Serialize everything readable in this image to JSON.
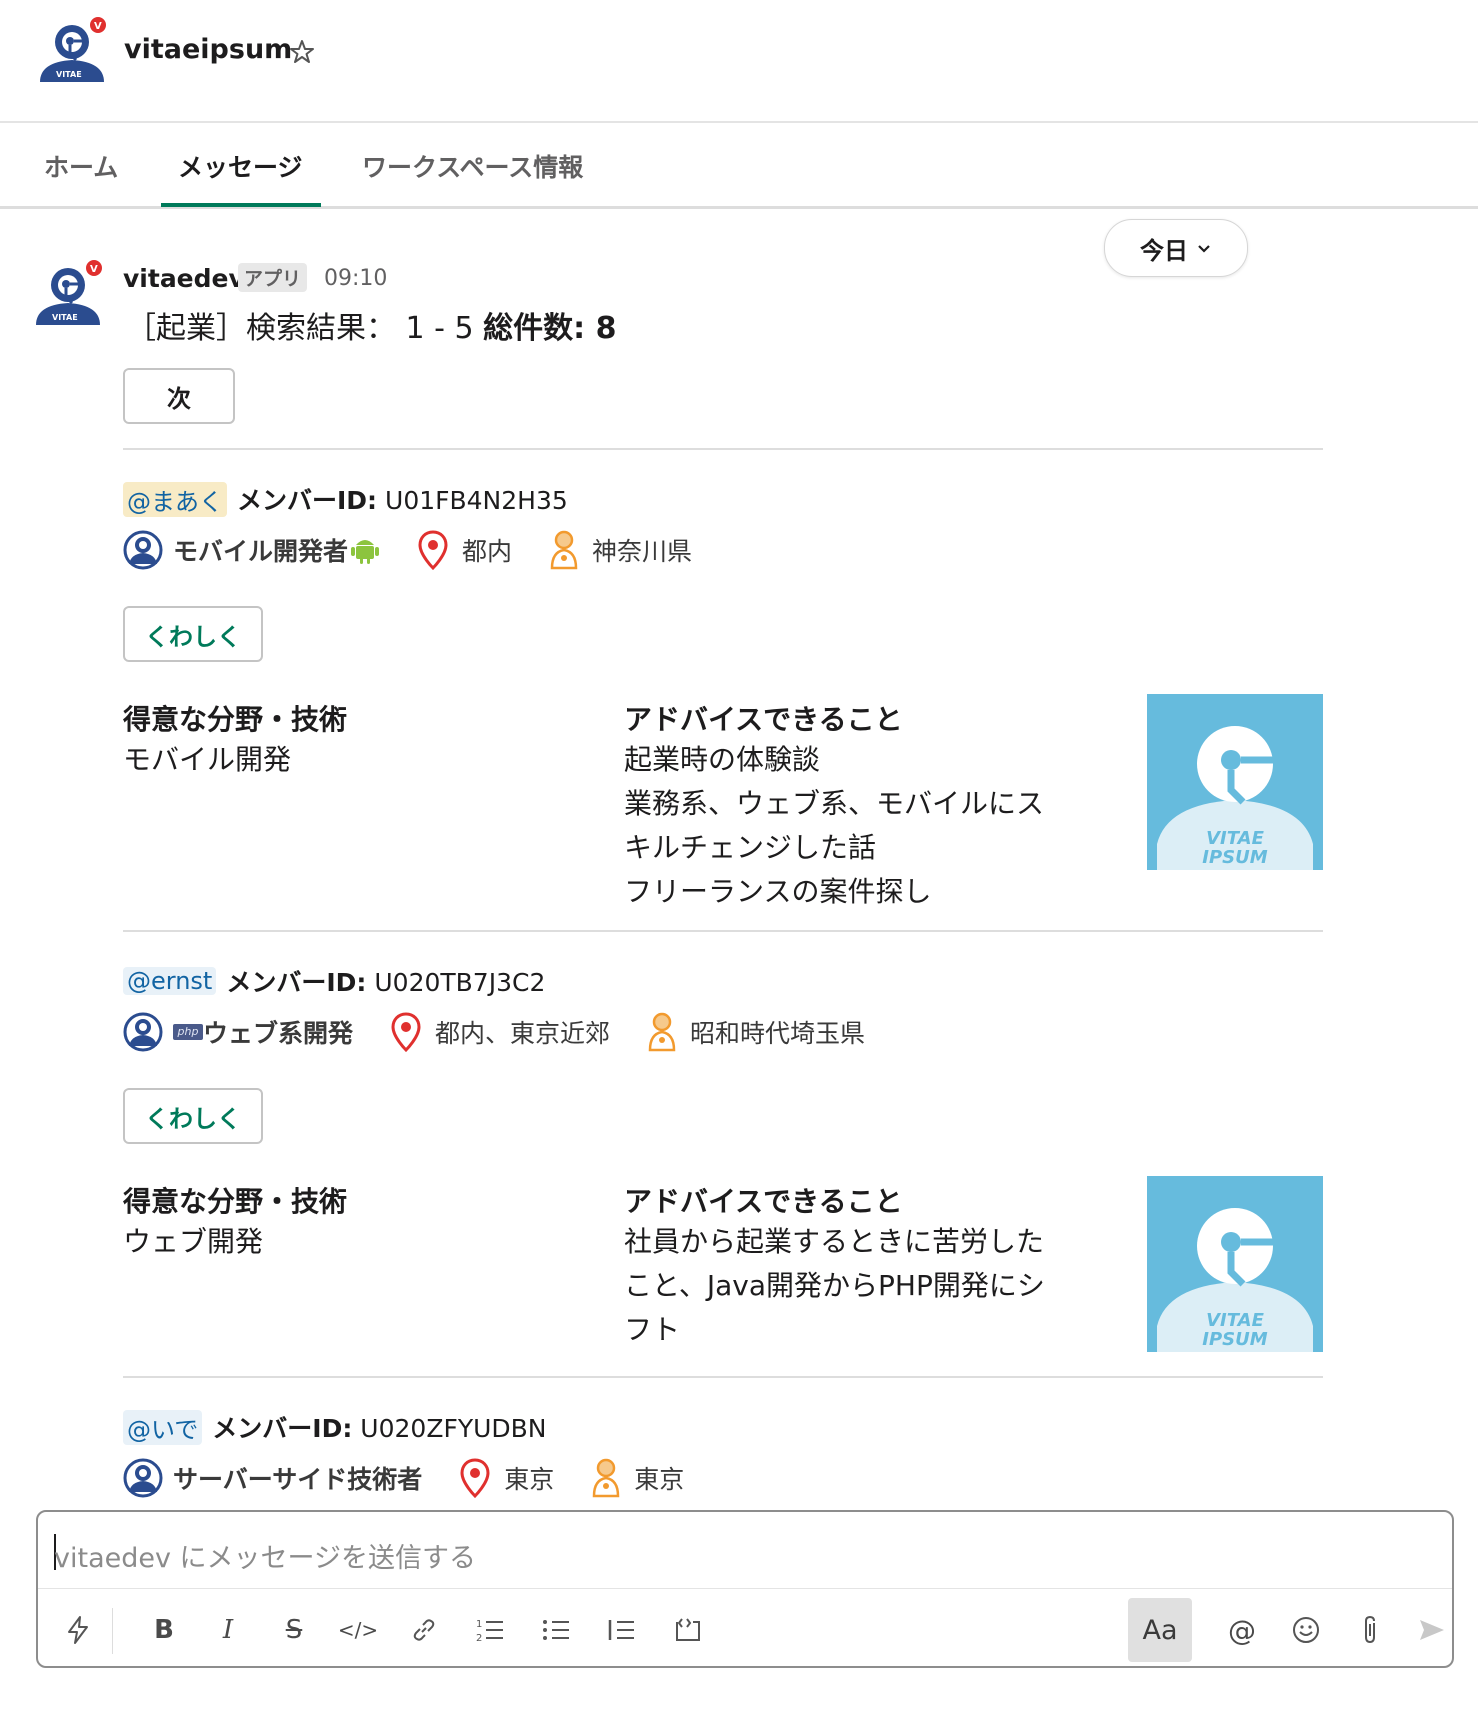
{
  "header": {
    "workspace_name": "vitaeipsum",
    "avatar_text": "VITAE"
  },
  "tabs": [
    {
      "label": "ホーム"
    },
    {
      "label": "メッセージ"
    },
    {
      "label": "ワークスペース情報"
    }
  ],
  "date_filter": {
    "label": "今日"
  },
  "message": {
    "sender": "vitaedev",
    "badge": "アプリ",
    "time": "09:10",
    "headline_prefix": "［起業］検索結果： 1 - 5 ",
    "headline_total": "総件数: 8",
    "next_button": "次"
  },
  "labels": {
    "member_id": "メンバーID:",
    "detail_button": "くわしく",
    "skills_title": "得意な分野・技術",
    "advice_title": "アドバイスできること",
    "thumb_line1": "VITAE",
    "thumb_line2": "IPSUM"
  },
  "members": [
    {
      "mention": "@まあく",
      "member_id": "U01FB4N2H35",
      "role": "モバイル開発者",
      "location": "都内",
      "origin": "神奈川県",
      "skills": "モバイル開発",
      "advice": [
        "起業時の体験談",
        "業務系、ウェブ系、モバイルにス",
        "キルチェンジした話",
        "フリーランスの案件探し"
      ]
    },
    {
      "mention": "@ernst",
      "member_id": "U020TB7J3C2",
      "role_tag": "php",
      "role": "ウェブ系開発",
      "location": "都内、東京近郊",
      "origin": "昭和時代埼玉県",
      "skills": "ウェブ開発",
      "advice": [
        "社員から起業するときに苦労した",
        "こと、Java開発からPHP開発にシ",
        "フト"
      ]
    },
    {
      "mention": "@いで",
      "member_id": "U020ZFYUDBN",
      "role": "サーバーサイド技術者",
      "location": "東京",
      "origin": "東京"
    }
  ],
  "composer": {
    "placeholder": "vitaedev にメッセージを送信する",
    "aa_label": "Aa"
  },
  "colors": {
    "accent": "#007a5a",
    "thumb_bg": "#66bbdd",
    "pin": "#e0302e",
    "baby": "#f29a2e",
    "mention_bg": "#f8ebc6"
  }
}
